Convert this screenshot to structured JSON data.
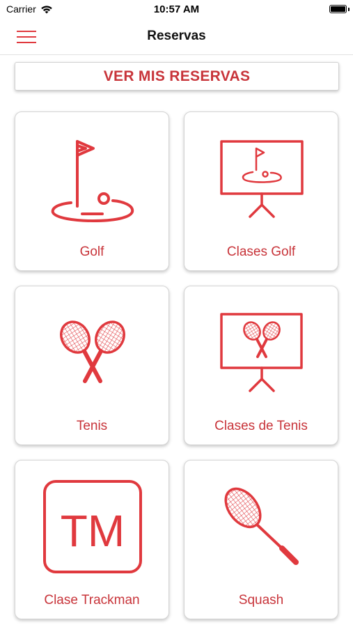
{
  "status_bar": {
    "carrier": "Carrier",
    "time": "10:57 AM"
  },
  "nav": {
    "title": "Reservas",
    "menu_icon": "hamburger-menu-icon"
  },
  "reservations_button": {
    "label": "VER MIS RESERVAS"
  },
  "tiles": [
    {
      "label": "Golf",
      "icon": "golf-flag-icon"
    },
    {
      "label": "Clases Golf",
      "icon": "golf-class-board-icon"
    },
    {
      "label": "Tenis",
      "icon": "tennis-rackets-icon"
    },
    {
      "label": "Clases de Tenis",
      "icon": "tennis-class-board-icon"
    },
    {
      "label": "Clase Trackman",
      "icon": "trackman-icon",
      "icon_text": "TM"
    },
    {
      "label": "Squash",
      "icon": "squash-racket-icon"
    }
  ],
  "colors": {
    "accent": "#e0393e",
    "label": "#c8343a"
  }
}
